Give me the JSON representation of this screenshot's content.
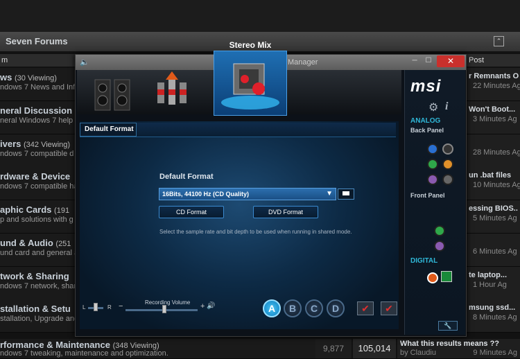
{
  "forum": {
    "title": "Seven Forums",
    "col_forum": "m",
    "col_lastpost": "Post",
    "rows": [
      {
        "name": "ws",
        "viewing": "(30 Viewing)",
        "desc": "ndows 7 News and Inf",
        "lp_title": "r Remnants O",
        "lp_time": "22 Minutes Ag"
      },
      {
        "name": "neral Discussion",
        "viewing": "",
        "desc": "neral Windows 7 help",
        "lp_title": "Won't Boot...",
        "lp_time": "3 Minutes Ag"
      },
      {
        "name": "ivers",
        "viewing": "(342 Viewing)",
        "desc": "ndows 7 compatible d",
        "lp_title": "",
        "lp_time": "28 Minutes Ag"
      },
      {
        "name": "rdware & Device",
        "viewing": "",
        "desc": "ndows 7 compatible ha",
        "lp_title": "un .bat files",
        "lp_time": "10 Minutes Ag"
      },
      {
        "name": "aphic Cards",
        "viewing": "(191",
        "desc": "p and solutions with g",
        "lp_title": "essing BIOS..",
        "lp_time": "5 Minutes Ag"
      },
      {
        "name": "und & Audio",
        "viewing": "(251",
        "desc": "und card and general a",
        "lp_title": "",
        "lp_time": "6 Minutes Ag"
      },
      {
        "name": "twork & Sharing",
        "viewing": "",
        "desc": "ndows 7 network, shar",
        "lp_title": "te laptop...",
        "lp_time": "1 Hour Ag"
      },
      {
        "name": "stallation & Setu",
        "viewing": "",
        "desc": "stallation, Upgrade and",
        "lp_title": "msung ssd...",
        "lp_time": "8 Minutes Ag"
      }
    ],
    "last_row": {
      "name": "rformance & Maintenance",
      "viewing": "(348 Viewing)",
      "desc": "ndows 7 tweaking, maintenance and optimization.",
      "threads": "9,877",
      "posts": "105,014",
      "lp_title": "What this results means ??",
      "lp_by": "by Claudiu",
      "lp_time": "9 Minutes Ag"
    }
  },
  "audio": {
    "window_title": "Manager",
    "device_label": "Stereo Mix",
    "brand": "msi",
    "analog_label": "ANALOG",
    "back_panel_label": "Back Panel",
    "front_panel_label": "Front Panel",
    "digital_label": "DIGITAL",
    "tab_label": "Default Format",
    "format_heading": "Default Format",
    "format_selected": "16Bits, 44100 Hz (CD Quality)",
    "cd_button": "CD Format",
    "dvd_button": "DVD Format",
    "hint": "Select the sample rate and bit depth to be used when running in shared mode.",
    "recording_volume_label": "Recording Volume",
    "balance_left": "L",
    "balance_right": "R",
    "vol_minus": "−",
    "vol_plus": "+",
    "channels": [
      "A",
      "B",
      "C",
      "D"
    ],
    "active_channel": "A",
    "close_glyph": "✕",
    "accent_color": "#2fb8d8"
  }
}
